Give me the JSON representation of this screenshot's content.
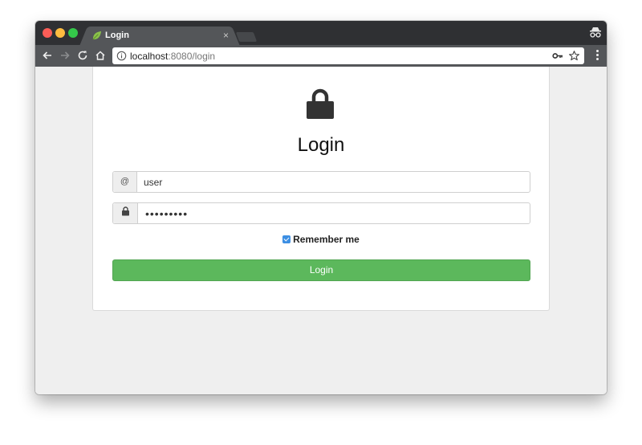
{
  "browser": {
    "tab_title": "Login",
    "tab_close": "×",
    "url_host": "localhost",
    "url_rest": ":8080/login"
  },
  "form": {
    "heading": "Login",
    "username_addon": "@",
    "username_value": "user",
    "password_value": "•••••••••",
    "remember_label": "Remember me",
    "remember_checked": true,
    "submit_label": "Login"
  },
  "colors": {
    "submit": "#5cb85c",
    "checkbox": "#3d8fe3"
  },
  "icons": {
    "back": "arrow-left-icon",
    "forward": "arrow-right-icon",
    "reload": "reload-icon",
    "home": "home-icon",
    "info": "info-icon",
    "key": "key-icon",
    "star": "star-icon",
    "menu": "vertical-dots-icon",
    "incognito": "incognito-icon",
    "lock": "lock-icon",
    "favicon": "leaf-icon"
  }
}
